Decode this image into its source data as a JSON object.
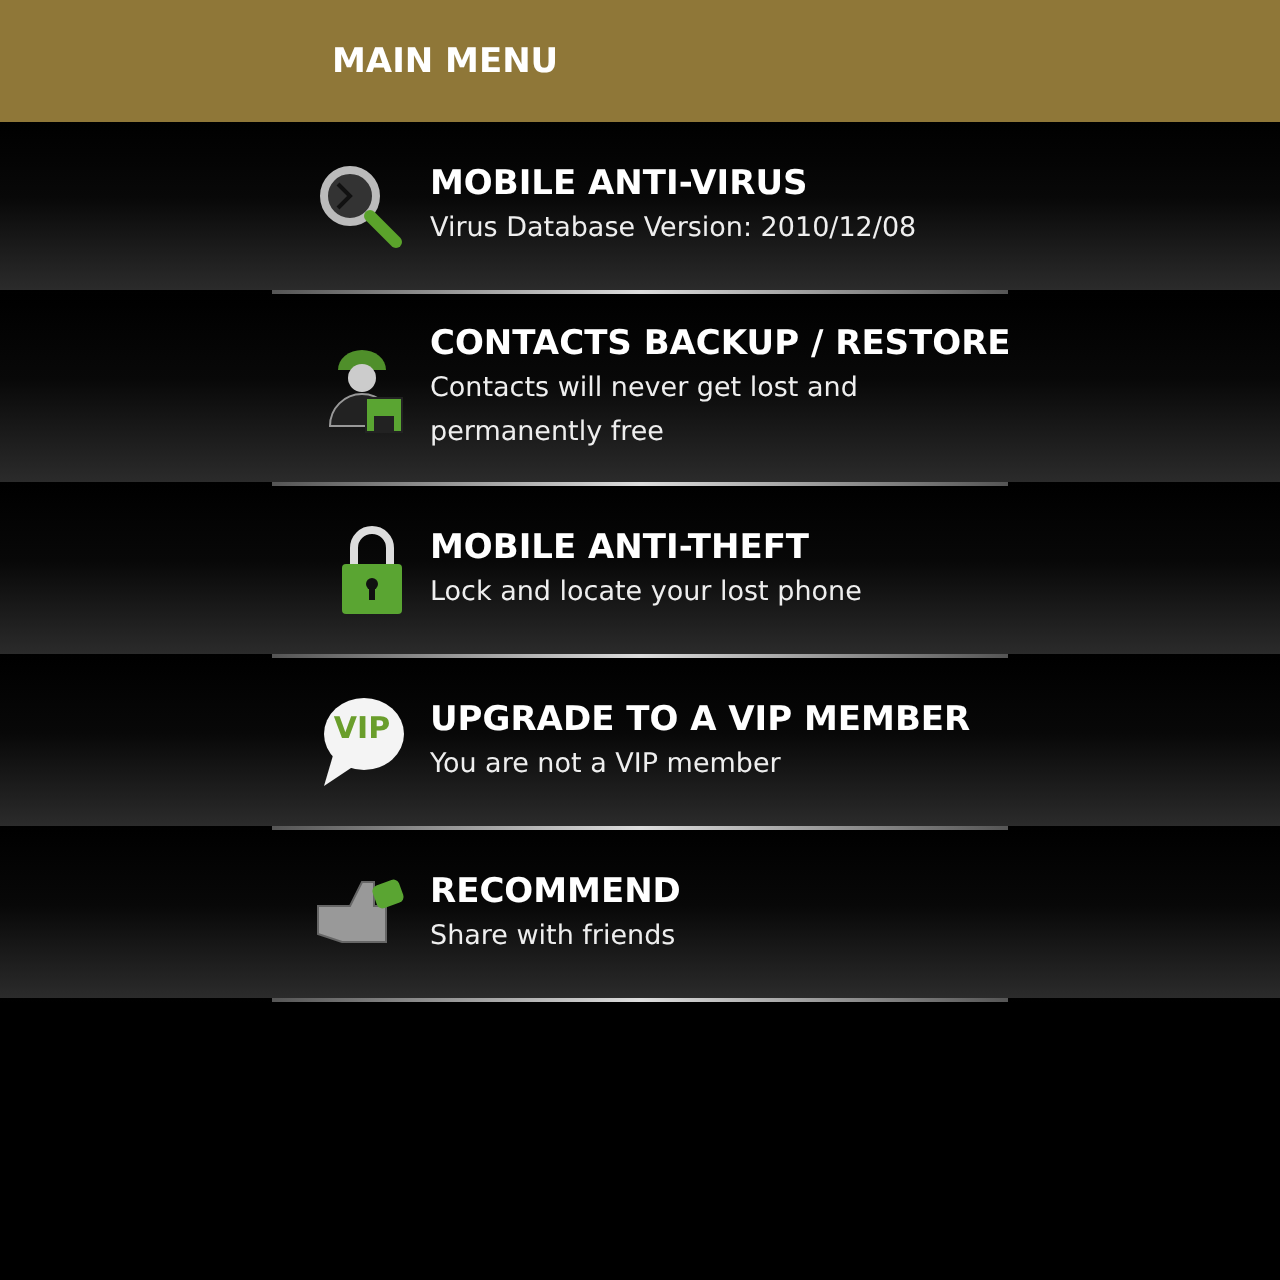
{
  "header": {
    "title": "MAIN MENU"
  },
  "items": [
    {
      "kind": "search",
      "title": "MOBILE ANTI-VIRUS",
      "subtitle": "Virus Database Version: 2010/12/08"
    },
    {
      "kind": "contacts",
      "title": "CONTACTS BACKUP / RESTORE",
      "subtitle": "Contacts will never get lost and permanently free"
    },
    {
      "kind": "lock",
      "title": "MOBILE ANTI-THEFT",
      "subtitle": "Lock and locate your lost phone"
    },
    {
      "kind": "vip",
      "badge": "VIP",
      "title": "UPGRADE TO A VIP MEMBER",
      "subtitle": "You are not a VIP member"
    },
    {
      "kind": "thumb",
      "title": "RECOMMEND",
      "subtitle": "Share with friends"
    }
  ]
}
